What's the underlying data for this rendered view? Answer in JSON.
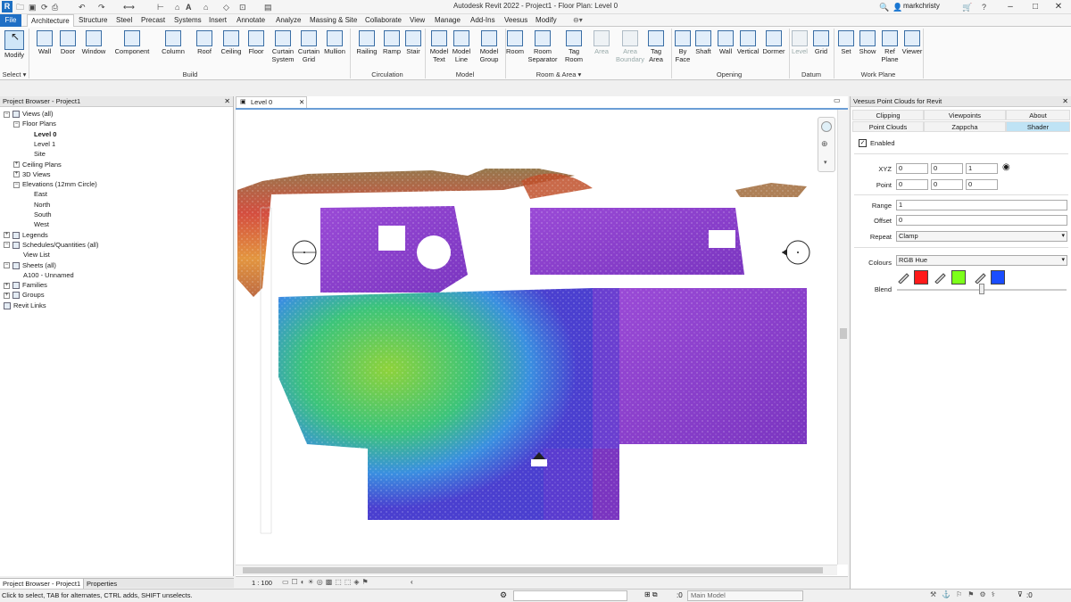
{
  "app": {
    "logo": "R",
    "title": "Autodesk Revit 2022 - Project1 - Floor Plan: Level 0",
    "user": "markchristy"
  },
  "colors": {
    "file_tab": "#1f6fc5",
    "active_prop_tab": "#bfe3f5",
    "accent": "#6b9ed6"
  },
  "tabs": [
    "File",
    "Architecture",
    "Structure",
    "Steel",
    "Precast",
    "Systems",
    "Insert",
    "Annotate",
    "Analyze",
    "Massing & Site",
    "Collaborate",
    "View",
    "Manage",
    "Add-Ins",
    "Veesus",
    "Modify"
  ],
  "ribbon": {
    "buttons": [
      {
        "id": "modify",
        "label": "Modify",
        "icon": "cursor-icon"
      },
      {
        "id": "wall",
        "label": "Wall",
        "icon": "wall-icon"
      },
      {
        "id": "door",
        "label": "Door",
        "icon": "door-icon"
      },
      {
        "id": "window",
        "label": "Window",
        "icon": "window-icon"
      },
      {
        "id": "component",
        "label": "Component",
        "icon": "component-icon"
      },
      {
        "id": "column",
        "label": "Column",
        "icon": "column-icon"
      },
      {
        "id": "roof",
        "label": "Roof",
        "icon": "roof-icon"
      },
      {
        "id": "ceiling",
        "label": "Ceiling",
        "icon": "ceiling-icon"
      },
      {
        "id": "floor",
        "label": "Floor",
        "icon": "floor-icon"
      },
      {
        "id": "curtain_system",
        "label": "Curtain\nSystem",
        "icon": "curtain-system-icon"
      },
      {
        "id": "curtain_grid",
        "label": "Curtain\nGrid",
        "icon": "curtain-grid-icon"
      },
      {
        "id": "mullion",
        "label": "Mullion",
        "icon": "mullion-icon"
      },
      {
        "id": "railing",
        "label": "Railing",
        "icon": "railing-icon"
      },
      {
        "id": "ramp",
        "label": "Ramp",
        "icon": "ramp-icon"
      },
      {
        "id": "stair",
        "label": "Stair",
        "icon": "stair-icon"
      },
      {
        "id": "model_text",
        "label": "Model\nText",
        "icon": "model-text-icon"
      },
      {
        "id": "model_line",
        "label": "Model\nLine",
        "icon": "model-line-icon"
      },
      {
        "id": "model_group",
        "label": "Model\nGroup",
        "icon": "model-group-icon"
      },
      {
        "id": "room",
        "label": "Room",
        "icon": "room-icon"
      },
      {
        "id": "room_separator",
        "label": "Room\nSeparator",
        "icon": "room-separator-icon"
      },
      {
        "id": "tag_room",
        "label": "Tag\nRoom",
        "icon": "tag-room-icon"
      },
      {
        "id": "area",
        "label": "Area",
        "icon": "area-icon",
        "disabled": true
      },
      {
        "id": "area_boundary",
        "label": "Area\nBoundary",
        "icon": "area-boundary-icon",
        "disabled": true
      },
      {
        "id": "tag_area",
        "label": "Tag\nArea",
        "icon": "tag-area-icon"
      },
      {
        "id": "by_face",
        "label": "By\nFace",
        "icon": "by-face-icon"
      },
      {
        "id": "shaft",
        "label": "Shaft",
        "icon": "shaft-icon"
      },
      {
        "id": "opening_wall",
        "label": "Wall",
        "icon": "wall-opening-icon"
      },
      {
        "id": "vertical",
        "label": "Vertical",
        "icon": "vertical-icon"
      },
      {
        "id": "dormer",
        "label": "Dormer",
        "icon": "dormer-icon"
      },
      {
        "id": "level",
        "label": "Level",
        "icon": "level-icon",
        "disabled": true
      },
      {
        "id": "grid",
        "label": "Grid",
        "icon": "grid-icon"
      },
      {
        "id": "set",
        "label": "Set",
        "icon": "set-icon"
      },
      {
        "id": "show",
        "label": "Show",
        "icon": "show-icon"
      },
      {
        "id": "ref_plane",
        "label": "Ref\nPlane",
        "icon": "ref-plane-icon"
      },
      {
        "id": "viewer",
        "label": "Viewer",
        "icon": "viewer-icon"
      }
    ],
    "groups": [
      "Select ▾",
      "Build",
      "Circulation",
      "Model",
      "Room & Area ▾",
      "Opening",
      "Datum",
      "Work Plane"
    ]
  },
  "project_browser": {
    "title": "Project Browser - Project1",
    "tree": [
      {
        "label": "Views (all)",
        "exp": "−",
        "icon": true
      },
      {
        "label": "Floor Plans",
        "exp": "−"
      },
      {
        "label": "Level 0",
        "bold": true
      },
      {
        "label": "Level 1"
      },
      {
        "label": "Site"
      },
      {
        "label": "Ceiling Plans",
        "exp": "+"
      },
      {
        "label": "3D Views",
        "exp": "+"
      },
      {
        "label": "Elevations (12mm Circle)",
        "exp": "−"
      },
      {
        "label": "East"
      },
      {
        "label": "North"
      },
      {
        "label": "South"
      },
      {
        "label": "West"
      },
      {
        "label": "Legends",
        "exp": "+",
        "icon": true
      },
      {
        "label": "Schedules/Quantities (all)",
        "exp": "−",
        "icon": true
      },
      {
        "label": "View List"
      },
      {
        "label": "Sheets (all)",
        "exp": "−",
        "icon": true
      },
      {
        "label": "A100 - Unnamed"
      },
      {
        "label": "Families",
        "exp": "+",
        "icon": true
      },
      {
        "label": "Groups",
        "exp": "+",
        "icon": true
      },
      {
        "label": "Revit Links",
        "icon": true
      }
    ],
    "bottom_tabs": [
      "Project Browser - Project1",
      "Properties"
    ]
  },
  "view": {
    "tab_label": "Level 0",
    "scale": "1 : 100"
  },
  "veesus": {
    "title": "Veesus Point Clouds for Revit",
    "tabs_row1": [
      "Clipping",
      "Viewpoints",
      "About"
    ],
    "tabs_row2": [
      "Point Clouds",
      "Zappcha",
      "Shader"
    ],
    "enabled_label": "Enabled",
    "xyz_label": "XYZ",
    "xyz": [
      "0",
      "0",
      "1"
    ],
    "point_label": "Point",
    "point": [
      "0",
      "0",
      "0"
    ],
    "range_label": "Range",
    "range": "1",
    "offset_label": "Offset",
    "offset": "0",
    "repeat_label": "Repeat",
    "repeat": "Clamp",
    "colours_label": "Colours",
    "colours": "RGB Hue",
    "blend_label": "Blend",
    "swatches": [
      "#ff1a1a",
      "#7cff1a",
      "#1a4dff"
    ]
  },
  "status": {
    "hint": "Click to select, TAB for alternates, CTRL adds, SHIFT unselects.",
    "model": "Main Model",
    "filter_count": ":0"
  }
}
